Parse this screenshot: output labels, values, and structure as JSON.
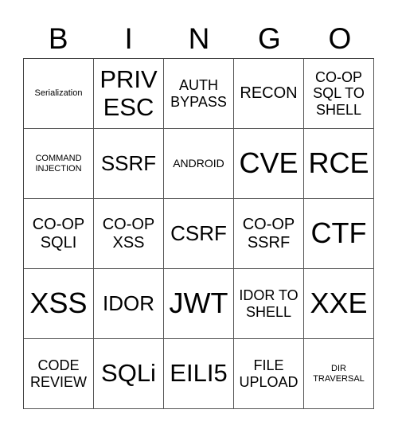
{
  "header": {
    "letters": [
      "B",
      "I",
      "N",
      "G",
      "O"
    ]
  },
  "cells": [
    {
      "text": "Serialization",
      "size": "s-xs"
    },
    {
      "text": "PRIV ESC",
      "size": "s-xl"
    },
    {
      "text": "AUTH BYPASS",
      "size": "s-md"
    },
    {
      "text": "RECON",
      "size": "s-md2"
    },
    {
      "text": "CO-OP SQL TO SHELL",
      "size": "s-md"
    },
    {
      "text": "COMMAND INJECTION",
      "size": "s-xs"
    },
    {
      "text": "SSRF",
      "size": "s-lg"
    },
    {
      "text": "ANDROID",
      "size": "s-sm"
    },
    {
      "text": "CVE",
      "size": "s-xxl"
    },
    {
      "text": "RCE",
      "size": "s-xxl"
    },
    {
      "text": "CO-OP SQLI",
      "size": "s-md2"
    },
    {
      "text": "CO-OP XSS",
      "size": "s-md2"
    },
    {
      "text": "CSRF",
      "size": "s-lg"
    },
    {
      "text": "CO-OP SSRF",
      "size": "s-md2"
    },
    {
      "text": "CTF",
      "size": "s-xxl"
    },
    {
      "text": "XSS",
      "size": "s-xxl"
    },
    {
      "text": "IDOR",
      "size": "s-lg"
    },
    {
      "text": "JWT",
      "size": "s-xxl"
    },
    {
      "text": "IDOR TO SHELL",
      "size": "s-md"
    },
    {
      "text": "XXE",
      "size": "s-xxl"
    },
    {
      "text": "CODE REVIEW",
      "size": "s-md"
    },
    {
      "text": "SQLi",
      "size": "s-xl"
    },
    {
      "text": "EILI5",
      "size": "s-xl"
    },
    {
      "text": "FILE UPLOAD",
      "size": "s-md"
    },
    {
      "text": "DIR TRAVERSAL",
      "size": "s-xs"
    }
  ]
}
